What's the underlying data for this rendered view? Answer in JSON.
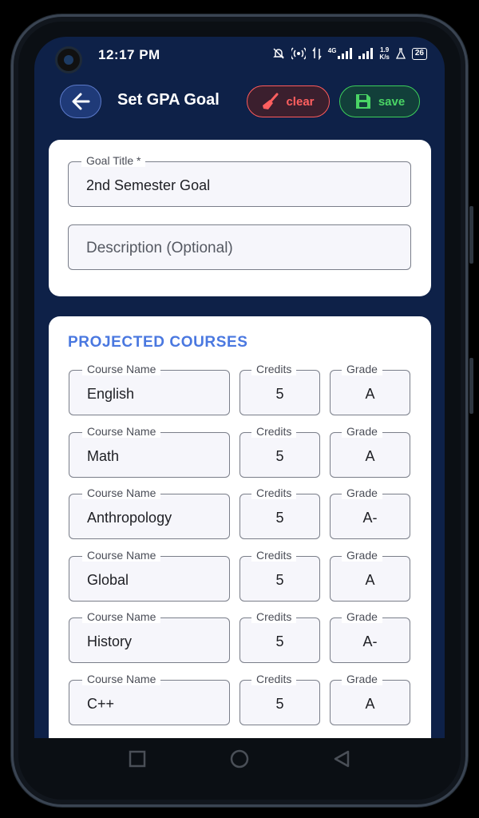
{
  "status_bar": {
    "time": "12:17 PM",
    "network": "4G",
    "net_speed_value": "1.9",
    "net_speed_unit": "K/s",
    "battery": "26"
  },
  "app_bar": {
    "title": "Set GPA Goal",
    "clear_label": "clear",
    "save_label": "save",
    "accent_color": "#4a78e0",
    "clear_color": "#ff5f5f",
    "save_color": "#4ad565"
  },
  "goal_form": {
    "title_label": "Goal Title *",
    "title_value": "2nd Semester Goal",
    "description_placeholder": "Description (Optional)"
  },
  "projected_courses": {
    "heading": "PROJECTED COURSES",
    "course_name_label": "Course Name",
    "credits_label": "Credits",
    "grade_label": "Grade",
    "rows": [
      {
        "name": "English",
        "credits": "5",
        "grade": "A"
      },
      {
        "name": "Math",
        "credits": "5",
        "grade": "A"
      },
      {
        "name": "Anthropology",
        "credits": "5",
        "grade": "A-"
      },
      {
        "name": "Global",
        "credits": "5",
        "grade": "A"
      },
      {
        "name": "History",
        "credits": "5",
        "grade": "A-"
      },
      {
        "name": "C++",
        "credits": "5",
        "grade": "A"
      }
    ]
  },
  "nav_bar": {
    "icons": [
      "recent-apps-icon",
      "home-icon",
      "back-icon"
    ]
  }
}
